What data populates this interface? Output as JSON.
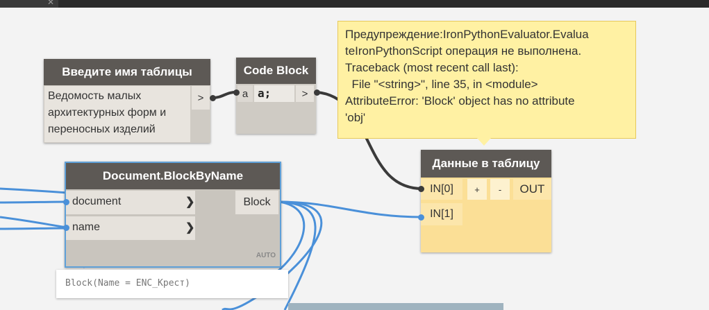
{
  "colors": {
    "canvas": "#f3f3f3",
    "wire_dark": "#3a3a3a",
    "wire_blue": "#4a90d9",
    "warning": "#fff1a3",
    "node_warning": "#fbdf96"
  },
  "string_node": {
    "title": "Введите имя таблицы",
    "value_lines": [
      "Ведомость малых",
      "архитектурных форм и",
      "переносных изделий"
    ],
    "output_arrow": ">"
  },
  "code_block": {
    "title": "Code Block",
    "input_port": "a",
    "code": "a;",
    "output_arrow": ">"
  },
  "block_by_name": {
    "title": "Document.BlockByName",
    "inputs": [
      "document",
      "name"
    ],
    "output": "Block",
    "lacing": "AUTO",
    "preview": "Block(Name = ENC_Крест)"
  },
  "table_node": {
    "title": "Данные в таблицу",
    "inputs": [
      "IN[0]",
      "IN[1]"
    ],
    "add_label": "+",
    "remove_label": "-",
    "output": "OUT"
  },
  "warning": {
    "lines": [
      "Предупреждение:IronPythonEvaluator.Evalua",
      "teIronPythonScript операция не выполнена.",
      "Traceback (most recent call last):",
      "  File \"<string>\", line 35, in <module>",
      "AttributeError: 'Block' object has no attribute",
      "'obj'"
    ]
  }
}
